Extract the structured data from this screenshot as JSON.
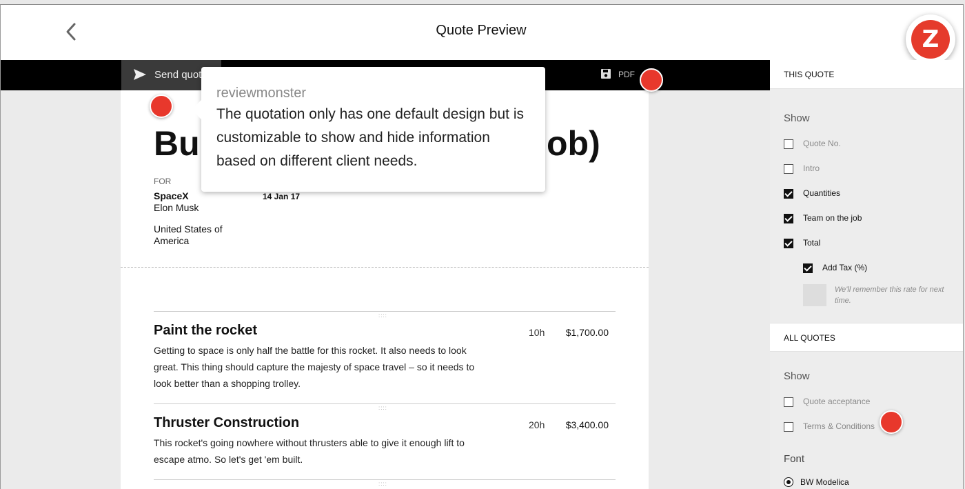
{
  "header": {
    "title": "Quote Preview",
    "logo_letter": "Z"
  },
  "toolbar": {
    "send_label": "Send quote",
    "pdf_label": "PDF"
  },
  "document": {
    "title": "Bui",
    "title_end": "ob)",
    "for_label": "FOR",
    "client_name": "SpaceX",
    "client_contact": "Elon Musk",
    "client_country": "United States of America",
    "date": "14 Jan 17",
    "items": [
      {
        "title": "Paint the rocket",
        "description": "Getting to space is only half the battle for this rocket. It also needs to look great. This thing should capture the majesty of space travel – so it needs to look better than a shopping trolley.",
        "hours": "10h",
        "price": "$1,700.00"
      },
      {
        "title": "Thruster Construction",
        "description": "This rocket's going nowhere without thrusters able to give it enough lift to escape atmo. So let's get 'em built.",
        "hours": "20h",
        "price": "$3,400.00"
      }
    ],
    "grip": "::::"
  },
  "sidebar": {
    "this_quote_header": "THIS QUOTE",
    "show_label": "Show",
    "this_quote_options": [
      {
        "label": "Quote No.",
        "checked": false
      },
      {
        "label": "Intro",
        "checked": false
      },
      {
        "label": "Quantities",
        "checked": true
      },
      {
        "label": "Team on the job",
        "checked": true
      },
      {
        "label": "Total",
        "checked": true
      },
      {
        "label": "Add Tax (%)",
        "checked": true
      }
    ],
    "tax_note": "We'll remember this rate for next time.",
    "all_quotes_header": "ALL QUOTES",
    "all_quotes_show_label": "Show",
    "all_quotes_options": [
      {
        "label": "Quote acceptance",
        "checked": false
      },
      {
        "label": "Terms & Conditions",
        "checked": false
      }
    ],
    "font_label": "Font",
    "font_option": "BW Modelica"
  },
  "tooltip": {
    "author": "reviewmonster",
    "message": "The quotation only has one default design but is customizable to show and hide information based on different client needs."
  },
  "colors": {
    "accent": "#e8382c",
    "toolbar": "#000000"
  }
}
